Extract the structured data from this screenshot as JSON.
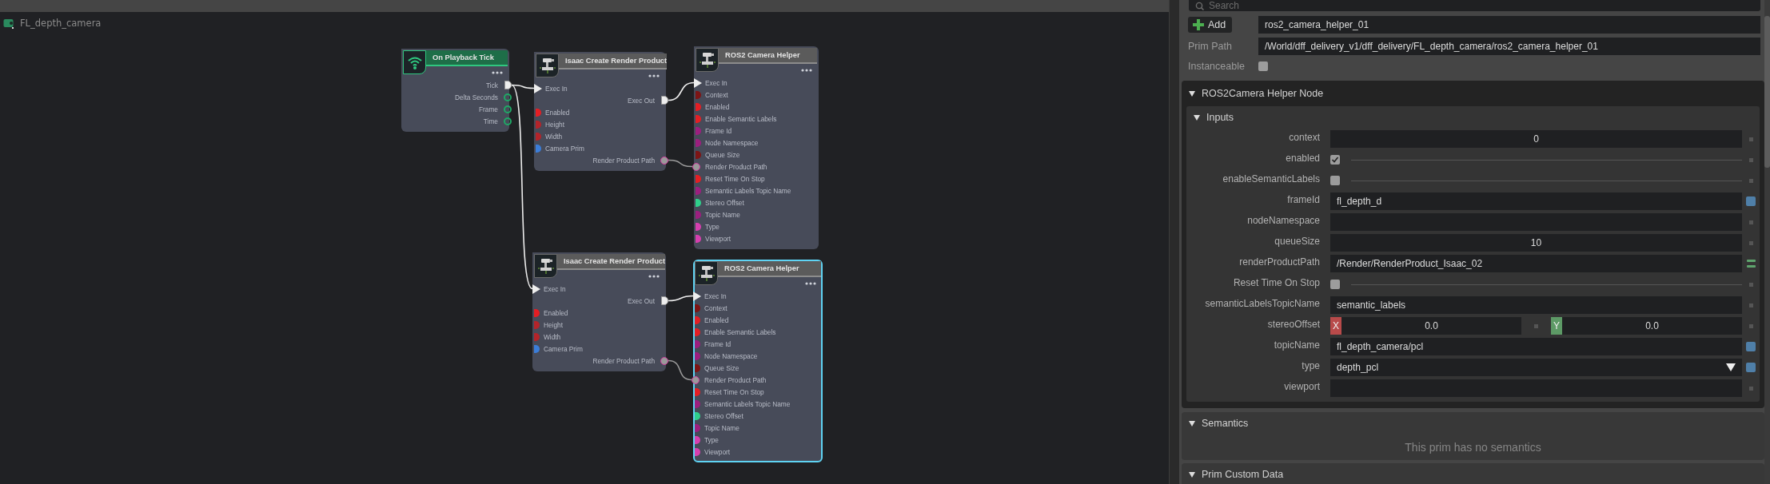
{
  "graph": {
    "breadcrumb": "FL_depth_camera",
    "nodes": [
      {
        "title": "On Playback Tick",
        "kind": "event",
        "selected": false,
        "ports": [
          {
            "label": "Tick",
            "output": true,
            "kind": "exec",
            "connected": true
          },
          {
            "label": "Delta Seconds",
            "output": true,
            "kind": "data",
            "color": "#1fa866",
            "connected": false
          },
          {
            "label": "Frame",
            "output": true,
            "kind": "data",
            "color": "#1fa866",
            "connected": false
          },
          {
            "label": "Time",
            "output": true,
            "kind": "data",
            "color": "#1fa866",
            "connected": false
          }
        ]
      },
      {
        "title": "Isaac Create Render Product",
        "kind": "action",
        "selected": false,
        "ports": [
          {
            "label": "Exec In",
            "output": false,
            "kind": "exec",
            "connected": true
          },
          {
            "label": "Exec Out",
            "output": true,
            "kind": "exec",
            "connected": true
          },
          {
            "label": "Enabled",
            "output": false,
            "kind": "data",
            "color": "#e31e24",
            "connected": false
          },
          {
            "label": "Height",
            "output": false,
            "kind": "data",
            "color": "#b3242a",
            "connected": false
          },
          {
            "label": "Width",
            "output": false,
            "kind": "data",
            "color": "#b3242a",
            "connected": false
          },
          {
            "label": "Camera Prim",
            "output": false,
            "kind": "data",
            "color": "#3b7dd8",
            "connected": false
          },
          {
            "label": "Render Product Path",
            "output": true,
            "kind": "data",
            "color": "#d23c9e",
            "connected": true
          }
        ]
      },
      {
        "title": "ROS2 Camera Helper",
        "kind": "action",
        "selected": false,
        "ports": [
          {
            "label": "Exec In",
            "output": false,
            "kind": "exec",
            "connected": true
          },
          {
            "label": "Context",
            "output": false,
            "kind": "data",
            "color": "#7d1515",
            "connected": false
          },
          {
            "label": "Enabled",
            "output": false,
            "kind": "data",
            "color": "#e31e24",
            "connected": false
          },
          {
            "label": "Enable Semantic Labels",
            "output": false,
            "kind": "data",
            "color": "#e31e24",
            "connected": false
          },
          {
            "label": "Frame Id",
            "output": false,
            "kind": "data",
            "color": "#9c1f7e",
            "connected": false
          },
          {
            "label": "Node Namespace",
            "output": false,
            "kind": "data",
            "color": "#9c1f7e",
            "connected": false
          },
          {
            "label": "Queue Size",
            "output": false,
            "kind": "data",
            "color": "#7d1515",
            "connected": false
          },
          {
            "label": "Render Product Path",
            "output": false,
            "kind": "data",
            "color": "#d23c9e",
            "connected": true
          },
          {
            "label": "Reset Time On Stop",
            "output": false,
            "kind": "data",
            "color": "#e31e24",
            "connected": false
          },
          {
            "label": "Semantic Labels Topic Name",
            "output": false,
            "kind": "data",
            "color": "#9c1f7e",
            "connected": false
          },
          {
            "label": "Stereo Offset",
            "output": false,
            "kind": "data",
            "color": "#2fcf8a",
            "connected": false
          },
          {
            "label": "Topic Name",
            "output": false,
            "kind": "data",
            "color": "#9c1f7e",
            "connected": false
          },
          {
            "label": "Type",
            "output": false,
            "kind": "data",
            "color": "#d63fae",
            "connected": false
          },
          {
            "label": "Viewport",
            "output": false,
            "kind": "data",
            "color": "#d63fae",
            "connected": false
          }
        ]
      },
      {
        "title": "Isaac Create Render Product",
        "kind": "action",
        "selected": false,
        "ports": [
          {
            "label": "Exec In",
            "output": false,
            "kind": "exec",
            "connected": true
          },
          {
            "label": "Exec Out",
            "output": true,
            "kind": "exec",
            "connected": true
          },
          {
            "label": "Enabled",
            "output": false,
            "kind": "data",
            "color": "#e31e24",
            "connected": false
          },
          {
            "label": "Height",
            "output": false,
            "kind": "data",
            "color": "#b3242a",
            "connected": false
          },
          {
            "label": "Width",
            "output": false,
            "kind": "data",
            "color": "#b3242a",
            "connected": false
          },
          {
            "label": "Camera Prim",
            "output": false,
            "kind": "data",
            "color": "#3b7dd8",
            "connected": false
          },
          {
            "label": "Render Product Path",
            "output": true,
            "kind": "data",
            "color": "#d23c9e",
            "connected": true
          }
        ]
      },
      {
        "title": "ROS2 Camera Helper",
        "kind": "action",
        "selected": true,
        "ports": [
          {
            "label": "Exec In",
            "output": false,
            "kind": "exec",
            "connected": true
          },
          {
            "label": "Context",
            "output": false,
            "kind": "data",
            "color": "#7d1515",
            "connected": false
          },
          {
            "label": "Enabled",
            "output": false,
            "kind": "data",
            "color": "#e31e24",
            "connected": false
          },
          {
            "label": "Enable Semantic Labels",
            "output": false,
            "kind": "data",
            "color": "#e31e24",
            "connected": false
          },
          {
            "label": "Frame Id",
            "output": false,
            "kind": "data",
            "color": "#9c1f7e",
            "connected": false
          },
          {
            "label": "Node Namespace",
            "output": false,
            "kind": "data",
            "color": "#9c1f7e",
            "connected": false
          },
          {
            "label": "Queue Size",
            "output": false,
            "kind": "data",
            "color": "#7d1515",
            "connected": false
          },
          {
            "label": "Render Product Path",
            "output": false,
            "kind": "data",
            "color": "#d23c9e",
            "connected": true
          },
          {
            "label": "Reset Time On Stop",
            "output": false,
            "kind": "data",
            "color": "#e31e24",
            "connected": false
          },
          {
            "label": "Semantic Labels Topic Name",
            "output": false,
            "kind": "data",
            "color": "#9c1f7e",
            "connected": false
          },
          {
            "label": "Stereo Offset",
            "output": false,
            "kind": "data",
            "color": "#2fcf8a",
            "connected": false
          },
          {
            "label": "Topic Name",
            "output": false,
            "kind": "data",
            "color": "#9c1f7e",
            "connected": false
          },
          {
            "label": "Type",
            "output": false,
            "kind": "data",
            "color": "#d63fae",
            "connected": false
          },
          {
            "label": "Viewport",
            "output": false,
            "kind": "data",
            "color": "#d63fae",
            "connected": false
          }
        ]
      }
    ]
  },
  "panel": {
    "search": {
      "placeholder": "Search"
    },
    "add_button": {
      "label": "Add"
    },
    "name": {
      "value": "ros2_camera_helper_01"
    },
    "prim_path": {
      "label": "Prim Path",
      "value": "/World/dff_delivery_v1/dff_delivery/FL_depth_camera/ros2_camera_helper_01"
    },
    "instanceable": {
      "label": "Instanceable",
      "checked": false
    },
    "node_section": {
      "title": "ROS2Camera Helper Node",
      "expanded": true,
      "inputs": {
        "title": "Inputs",
        "expanded": true,
        "rows": [
          {
            "label": "context",
            "kind": "number",
            "value": "0",
            "modified": false,
            "connected": false
          },
          {
            "label": "enabled",
            "kind": "bool",
            "checked": true,
            "modified": false,
            "connected": false
          },
          {
            "label": "enableSemanticLabels",
            "kind": "bool",
            "checked": false,
            "modified": false,
            "connected": false
          },
          {
            "label": "frameId",
            "kind": "text",
            "value": "fl_depth_d",
            "modified": true,
            "connected": false
          },
          {
            "label": "nodeNamespace",
            "kind": "text",
            "modified": false,
            "connected": false
          },
          {
            "label": "queueSize",
            "kind": "number",
            "value": "10",
            "modified": false,
            "connected": false
          },
          {
            "label": "renderProductPath",
            "kind": "text",
            "value": "/Render/RenderProduct_Isaac_02",
            "modified": false,
            "connected": true
          },
          {
            "label": "Reset Time On Stop",
            "kind": "bool",
            "checked": false,
            "modified": false,
            "connected": false
          },
          {
            "label": "semanticLabelsTopicName",
            "kind": "text",
            "value": "semantic_labels",
            "modified": false,
            "connected": false
          },
          {
            "label": "stereoOffset",
            "kind": "vector2",
            "components": [
              {
                "axis": "X",
                "value": "0.0"
              },
              {
                "axis": "Y",
                "value": "0.0"
              }
            ],
            "modified": false,
            "connected": false
          },
          {
            "label": "topicName",
            "kind": "text",
            "value": "fl_depth_camera/pcl",
            "modified": true,
            "connected": false
          },
          {
            "label": "type",
            "kind": "dropdown",
            "value": "depth_pcl",
            "modified": true,
            "connected": false
          },
          {
            "label": "viewport",
            "kind": "text",
            "modified": false,
            "connected": false
          }
        ]
      }
    },
    "semantics": {
      "title": "Semantics",
      "expanded": true,
      "message": "This prim has no semantics"
    },
    "custom_data": {
      "title": "Prim Custom Data",
      "expanded": true
    }
  }
}
